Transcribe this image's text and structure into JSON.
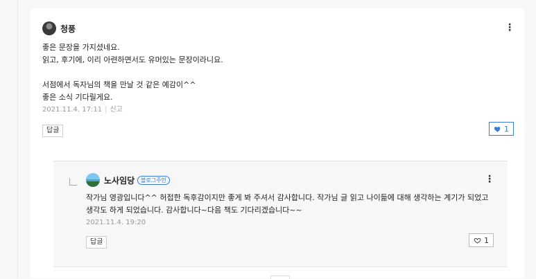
{
  "comment": {
    "author": "청풍",
    "lines": [
      "좋은 문장을 가지셨네요.",
      "읽고, 후기에, 이리 아련하면서도 유머있는 문장이라니요.",
      "",
      "서점에서 독자님의 책을 만날 것 같은 예감이^^",
      "좋은 소식 기다릴게요."
    ],
    "timestamp": "2021.11.4. 17:11",
    "report_label": "신고",
    "reply_button": "답글",
    "like_count": "1",
    "menu": "⋮"
  },
  "reply": {
    "author": "노사임당",
    "badge": "블로그주인",
    "text": "작가님 영광입니다^^ 허접한 독후감이지만 좋게 봐 주셔서 감사합니다. 작가님 글 읽고 나이듦에 대해 생각하는 계기가 되었고 생각도 하게 되었습니다. 감사합니다~다음 책도 기다리겠습니다~~",
    "timestamp": "2021.11.4. 19:20",
    "reply_button": "답글",
    "like_count": "1",
    "menu": "⋮"
  }
}
